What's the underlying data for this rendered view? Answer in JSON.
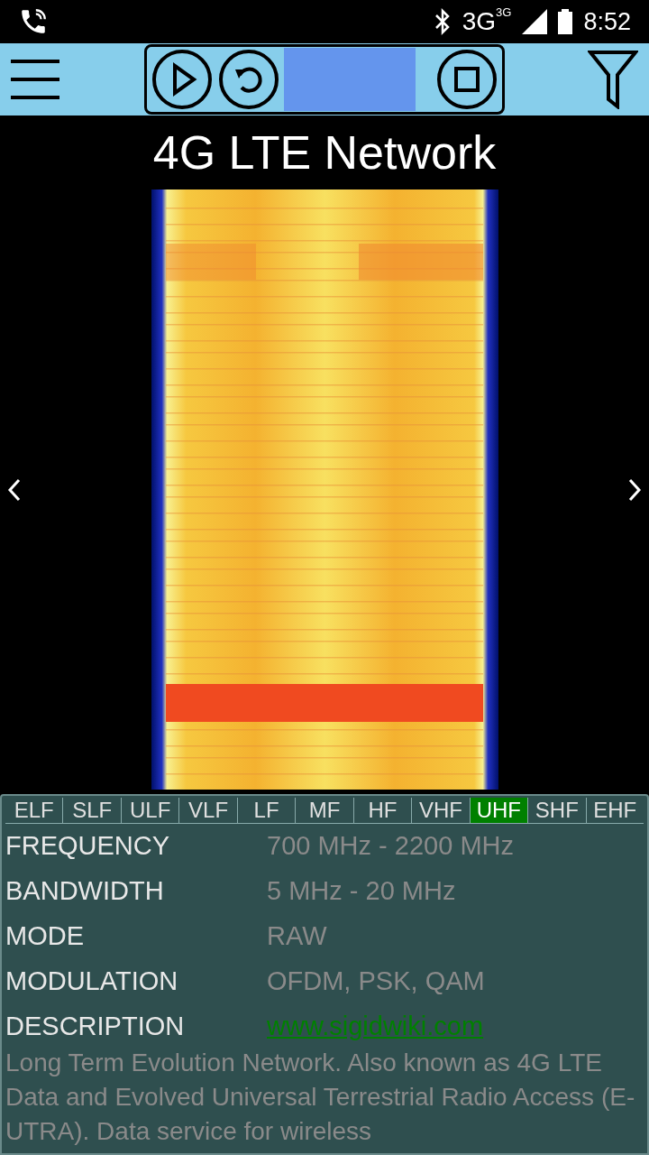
{
  "status_bar": {
    "network": "3G",
    "network_small": "3G",
    "time": "8:52"
  },
  "title": "4G LTE Network",
  "bands": [
    {
      "label": "ELF",
      "selected": false
    },
    {
      "label": "SLF",
      "selected": false
    },
    {
      "label": "ULF",
      "selected": false
    },
    {
      "label": "VLF",
      "selected": false
    },
    {
      "label": "LF",
      "selected": false
    },
    {
      "label": "MF",
      "selected": false
    },
    {
      "label": "HF",
      "selected": false
    },
    {
      "label": "VHF",
      "selected": false
    },
    {
      "label": "UHF",
      "selected": true
    },
    {
      "label": "SHF",
      "selected": false
    },
    {
      "label": "EHF",
      "selected": false
    }
  ],
  "properties": [
    {
      "label": "FREQUENCY",
      "value": "700 MHz - 2200 MHz",
      "kind": "text"
    },
    {
      "label": "BANDWIDTH",
      "value": "5 MHz - 20 MHz",
      "kind": "text"
    },
    {
      "label": "MODE",
      "value": "RAW",
      "kind": "text"
    },
    {
      "label": "MODULATION",
      "value": "OFDM, PSK, QAM",
      "kind": "text"
    },
    {
      "label": "DESCRIPTION",
      "value": "www.sigidwiki.com",
      "kind": "link"
    }
  ],
  "description": "Long Term Evolution Network. Also known as 4G LTE Data and Evolved Universal Terrestrial Radio Access (E-UTRA). Data service for wireless"
}
